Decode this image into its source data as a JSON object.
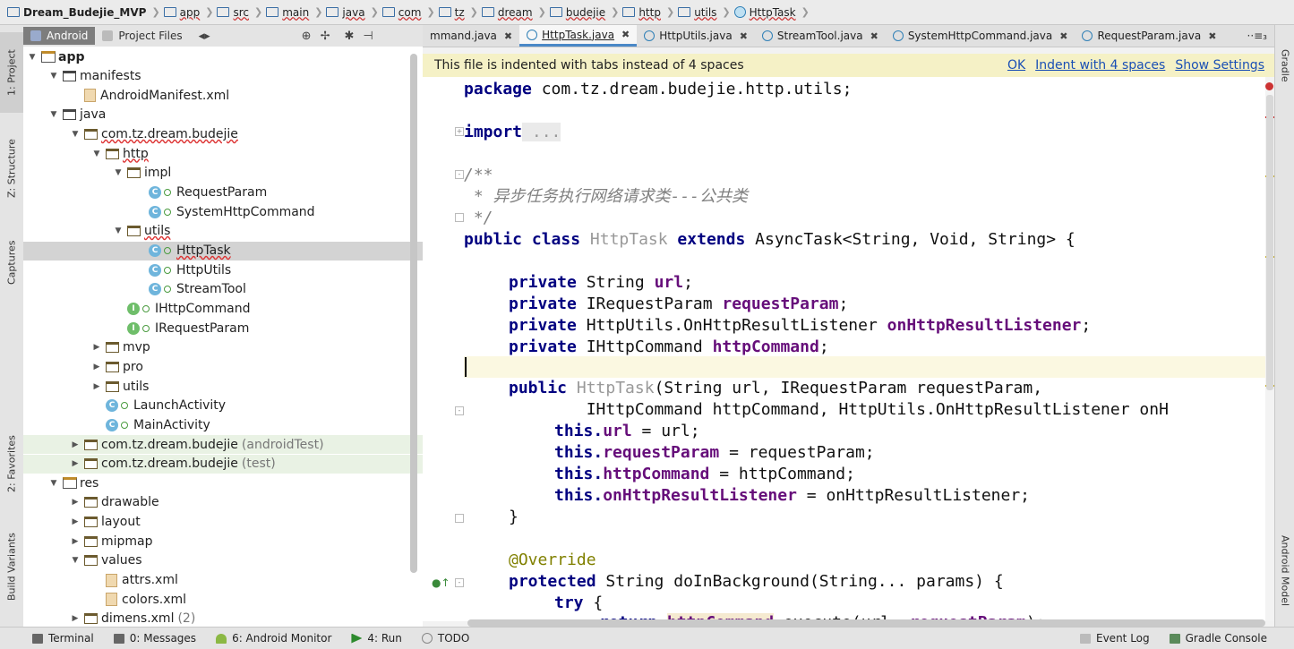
{
  "breadcrumb": [
    "Dream_Budejie_MVP",
    "app",
    "src",
    "main",
    "java",
    "com",
    "tz",
    "dream",
    "budejie",
    "http",
    "utils",
    "HttpTask"
  ],
  "project_panel": {
    "tab_android": "Android",
    "tab_project_files": "Project Files",
    "tree": [
      {
        "label": "app",
        "suffix": ""
      },
      {
        "label": "manifests",
        "suffix": ""
      },
      {
        "label": "AndroidManifest.xml",
        "suffix": ""
      },
      {
        "label": "java",
        "suffix": ""
      },
      {
        "label": "com.tz.dream.budejie",
        "suffix": ""
      },
      {
        "label": "http",
        "suffix": ""
      },
      {
        "label": "impl",
        "suffix": ""
      },
      {
        "label": "RequestParam",
        "suffix": ""
      },
      {
        "label": "SystemHttpCommand",
        "suffix": ""
      },
      {
        "label": "utils",
        "suffix": ""
      },
      {
        "label": "HttpTask",
        "suffix": ""
      },
      {
        "label": "HttpUtils",
        "suffix": ""
      },
      {
        "label": "StreamTool",
        "suffix": ""
      },
      {
        "label": "IHttpCommand",
        "suffix": ""
      },
      {
        "label": "IRequestParam",
        "suffix": ""
      },
      {
        "label": "mvp",
        "suffix": ""
      },
      {
        "label": "pro",
        "suffix": ""
      },
      {
        "label": "utils",
        "suffix": ""
      },
      {
        "label": "LaunchActivity",
        "suffix": ""
      },
      {
        "label": "MainActivity",
        "suffix": ""
      },
      {
        "label": "com.tz.dream.budejie",
        "suffix": "(androidTest)"
      },
      {
        "label": "com.tz.dream.budejie",
        "suffix": "(test)"
      },
      {
        "label": "res",
        "suffix": ""
      },
      {
        "label": "drawable",
        "suffix": ""
      },
      {
        "label": "layout",
        "suffix": ""
      },
      {
        "label": "mipmap",
        "suffix": ""
      },
      {
        "label": "values",
        "suffix": ""
      },
      {
        "label": "attrs.xml",
        "suffix": ""
      },
      {
        "label": "colors.xml",
        "suffix": ""
      },
      {
        "label": "dimens.xml",
        "suffix": "(2)"
      }
    ]
  },
  "left_strip": [
    "1: Project",
    "Z: Structure",
    "Captures",
    "2: Favorites",
    "Build Variants"
  ],
  "right_strip": [
    "Gradle",
    "Android Model"
  ],
  "editor_tabs": [
    "mmand.java",
    "HttpTask.java",
    "HttpUtils.java",
    "StreamTool.java",
    "SystemHttpCommand.java",
    "RequestParam.java"
  ],
  "tab_menu": "··≡₃",
  "notification": {
    "message": "This file is indented with tabs instead of 4 spaces",
    "ok": "OK",
    "indent": "Indent with 4 spaces",
    "settings": "Show Settings"
  },
  "code": {
    "l_package_kw": "package",
    "l_package_name": " com.tz.dream.budejie.http.utils;",
    "l_import_kw": "import",
    "l_import_dots": " ...",
    "l_cm1": "/**",
    "l_cm2": " * 异步任务执行网络请求类---公共类",
    "l_cm3": " */",
    "l_class": [
      "public class ",
      "HttpTask",
      " extends ",
      "AsyncTask<String, Void, String> {"
    ],
    "f1": [
      "private ",
      "String ",
      "url",
      ";"
    ],
    "f2": [
      "private ",
      "IRequestParam ",
      "requestParam",
      ";"
    ],
    "f3": [
      "private ",
      "HttpUtils.OnHttpResultListener ",
      "onHttpResultListener",
      ";"
    ],
    "f4": [
      "private ",
      "IHttpCommand ",
      "httpCommand",
      ";"
    ],
    "ctor1": [
      "public ",
      "HttpTask",
      "(String url, IRequestParam requestParam,"
    ],
    "ctor2": "        IHttpCommand httpCommand, HttpUtils.OnHttpResultListener onH",
    "a1": [
      "this.",
      "url",
      " = url;"
    ],
    "a2": [
      "this.",
      "requestParam",
      " = requestParam;"
    ],
    "a3": [
      "this.",
      "httpCommand",
      " = httpCommand;"
    ],
    "a4": [
      "this.",
      "onHttpResultListener",
      " = onHttpResultListener;"
    ],
    "close": "}",
    "override": "@Override",
    "dib": [
      "protected ",
      "String doInBackground(String... params) {"
    ],
    "try": [
      "try",
      " {"
    ],
    "ret": [
      "return ",
      "httpCommand",
      ".execute(url, ",
      "requestParam",
      ");"
    ]
  },
  "bottom_bar": [
    "Terminal",
    "0: Messages",
    "6: Android Monitor",
    "4: Run",
    "TODO",
    "Event Log",
    "Gradle Console"
  ]
}
